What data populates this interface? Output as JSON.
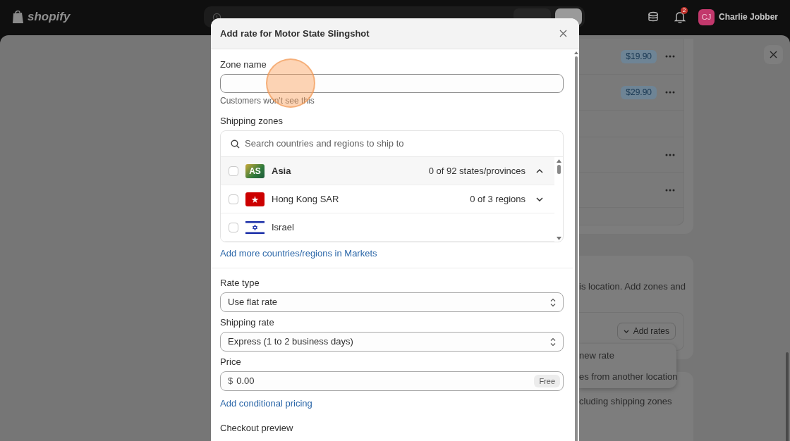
{
  "topbar": {
    "logo": "shopify",
    "save_bar": {
      "buttons": [
        {
          "kind": "secondary"
        },
        {
          "kind": "primary"
        }
      ]
    },
    "notifications": "2",
    "user": {
      "initials": "CJ",
      "name": "Charlie Jobber"
    }
  },
  "background": {
    "rate_rows": [
      {
        "kind": "priced",
        "price": "$19.90"
      },
      {
        "kind": "priced",
        "price": "$29.90"
      },
      {
        "kind": "actions"
      },
      {
        "kind": "actions"
      }
    ],
    "zones_text": "is location. Add zones and",
    "add_rates": "Add rates",
    "menu_items": [
      "new rate",
      "es from another location"
    ],
    "footer_text": "cluding shipping zones"
  },
  "modal": {
    "title": "Add rate for Motor State Slingshot",
    "zone_name": {
      "label": "Zone name",
      "helper": "Customers won't see this"
    },
    "shipping_zones": {
      "label": "Shipping zones",
      "search_placeholder": "Search countries and regions to ship to",
      "items": [
        {
          "kind": "region",
          "badge": "AS",
          "name": "Asia",
          "count": "0 of 92 states/provinces",
          "checked": false,
          "expanded": true,
          "selected": true
        },
        {
          "kind": "hong_kong",
          "name": "Hong Kong SAR",
          "count": "0 of 3 regions",
          "checked": false,
          "expanded": false,
          "selected": false
        },
        {
          "kind": "israel",
          "name": "Israel",
          "checked": false,
          "selected": false
        }
      ],
      "link": "Add more countries/regions in Markets"
    },
    "rate_type": {
      "label": "Rate type",
      "value": "Use flat rate"
    },
    "shipping_rate": {
      "label": "Shipping rate",
      "value": "Express (1 to 2 business days)"
    },
    "price": {
      "label": "Price",
      "prefix": "$",
      "value": "0.00",
      "badge": "Free"
    },
    "conditional_link": "Add conditional pricing",
    "checkout_preview": "Checkout preview"
  }
}
